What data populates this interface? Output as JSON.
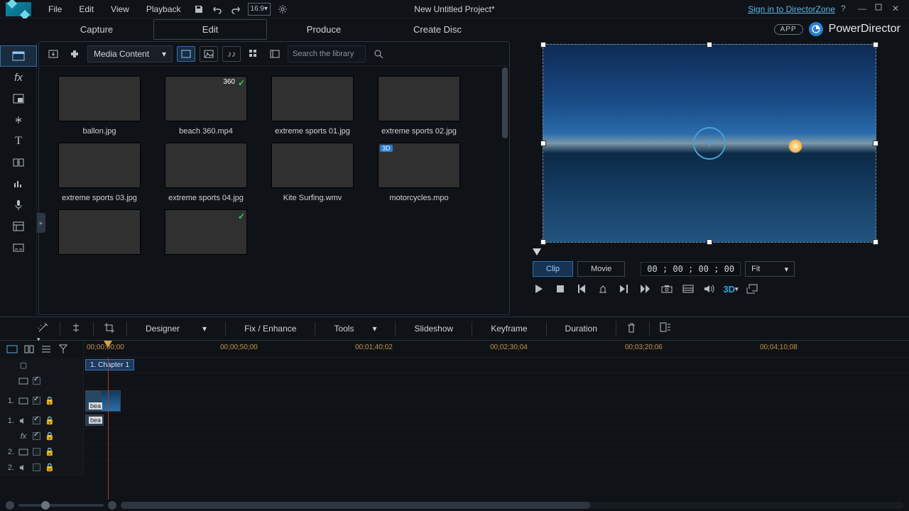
{
  "menu": {
    "file": "File",
    "edit": "Edit",
    "view": "View",
    "playback": "Playback",
    "aspect": "16:9"
  },
  "title": "New Untitled Project*",
  "header": {
    "signin": "Sign in to DirectorZone",
    "app_pill": "APP",
    "brand": "PowerDirector"
  },
  "modes": {
    "capture": "Capture",
    "edit": "Edit",
    "produce": "Produce",
    "create_disc": "Create Disc"
  },
  "library": {
    "media_select": "Media Content",
    "search_placeholder": "Search the library",
    "items": [
      {
        "label": "ballon.jpg"
      },
      {
        "label": "beach 360.mp4",
        "badge": "360",
        "check": true
      },
      {
        "label": "extreme sports 01.jpg"
      },
      {
        "label": "extreme sports 02.jpg"
      },
      {
        "label": "extreme sports 03.jpg"
      },
      {
        "label": "extreme sports 04.jpg"
      },
      {
        "label": "Kite Surfing.wmv"
      },
      {
        "label": "motorcycles.mpo",
        "badge": "3D"
      },
      {
        "label": ""
      },
      {
        "label": "",
        "check": true
      }
    ]
  },
  "preview": {
    "clip": "Clip",
    "movie": "Movie",
    "timecode": "00 ; 00 ; 00 ; 00",
    "fit": "Fit",
    "threeD": "3D"
  },
  "actionbar": {
    "designer": "Designer",
    "fix": "Fix / Enhance",
    "tools": "Tools",
    "slideshow": "Slideshow",
    "keyframe": "Keyframe",
    "duration": "Duration"
  },
  "ruler": [
    "00;00;00;00",
    "00;00;50;00",
    "00;01;40;02",
    "00;02;30;04",
    "00;03;20;06",
    "00;04;10;08"
  ],
  "timeline": {
    "chapter": "1. Chapter 1",
    "tracks": [
      {
        "num": "",
        "icon": "chapter",
        "chk": false,
        "lock": false
      },
      {
        "num": "",
        "icon": "video",
        "chk": true,
        "lock": false
      },
      {
        "num": "1.",
        "icon": "video",
        "chk": true,
        "lock": true,
        "tall": true,
        "clip": "bea"
      },
      {
        "num": "1.",
        "icon": "audio",
        "chk": true,
        "lock": true,
        "aclip": "bea"
      },
      {
        "num": "",
        "icon": "fx",
        "chk": true,
        "lock": true
      },
      {
        "num": "2.",
        "icon": "video",
        "chk": false,
        "lock": true
      },
      {
        "num": "2.",
        "icon": "audio",
        "chk": false,
        "lock": true
      }
    ]
  }
}
